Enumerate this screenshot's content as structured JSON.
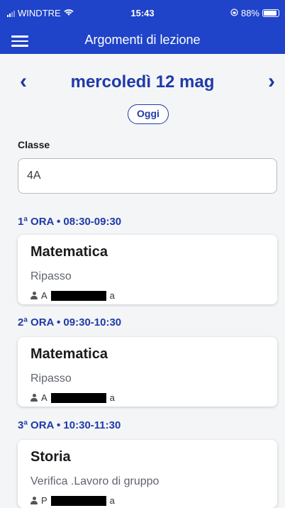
{
  "status_bar": {
    "carrier": "WINDTRE",
    "time": "15:43",
    "battery": "88%"
  },
  "app_bar": {
    "title": "Argomenti di lezione"
  },
  "date_nav": {
    "prev": "‹",
    "date": "mercoledì 12 mag",
    "next": "›",
    "today_label": "Oggi"
  },
  "class_field": {
    "label": "Classe",
    "value": "4A"
  },
  "lessons": [
    {
      "hour": "1ª ORA • 08:30-09:30",
      "subject": "Matematica",
      "topic": "Ripasso",
      "teacher_first": "A",
      "teacher_last": "a"
    },
    {
      "hour": "2ª ORA • 09:30-10:30",
      "subject": "Matematica",
      "topic": "Ripasso",
      "teacher_first": "A",
      "teacher_last": "a"
    },
    {
      "hour": "3ª ORA • 10:30-11:30",
      "subject": "Storia",
      "topic": "Verifica .Lavoro di gruppo",
      "teacher_first": "P",
      "teacher_last": "a"
    }
  ],
  "colors": {
    "primary": "#1f43c9",
    "accent_text": "#1f3aa8"
  }
}
